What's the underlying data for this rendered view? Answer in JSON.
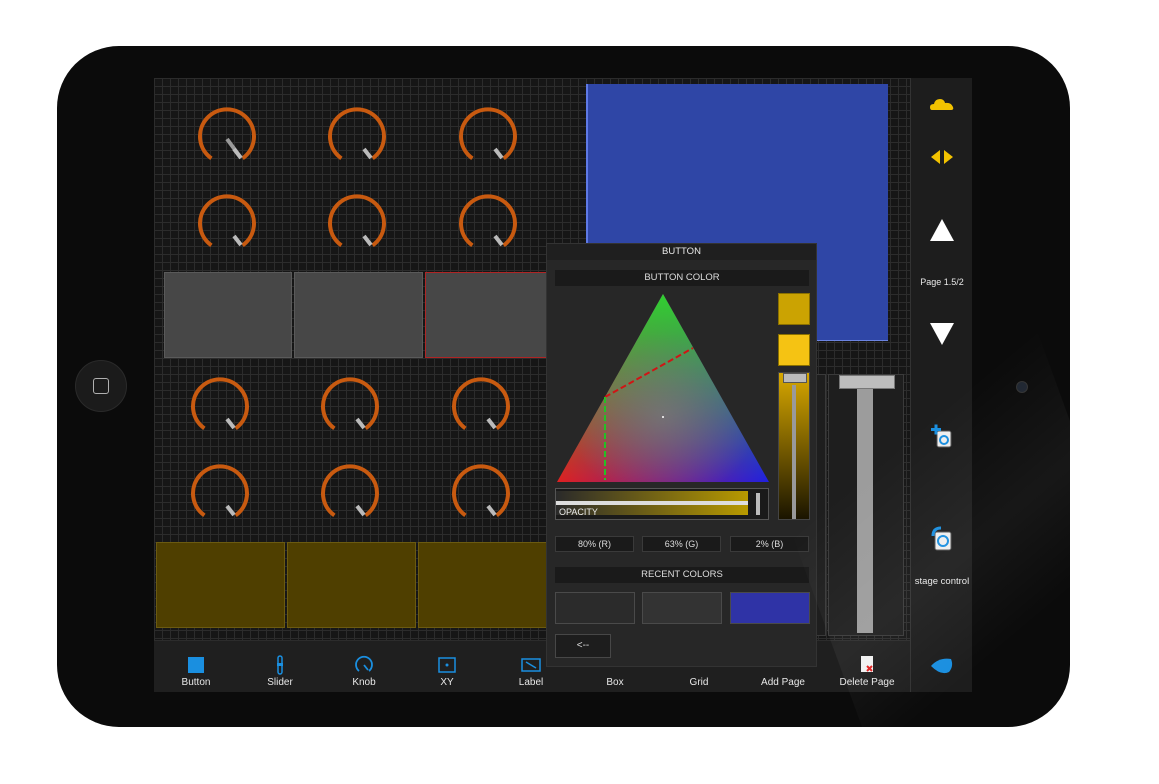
{
  "dialog": {
    "title": "BUTTON",
    "color_section": "BUTTON COLOR",
    "opacity_label": "OPACITY",
    "rgb": {
      "r": "80% (R)",
      "g": "63% (G)",
      "b": "2% (B)"
    },
    "recent_section": "RECENT COLORS",
    "recent_colors": [
      "#2b2b2b",
      "#333333",
      "#2f33a6"
    ],
    "back_label": "<--",
    "current_color": "#cba302",
    "new_color": "#f5c313"
  },
  "sidebar": {
    "page_label": "Page 1.5/2",
    "stage_label": "stage control",
    "icons": [
      "cloud-icon",
      "resize-horizontal-icon",
      "page-up-icon",
      "page-down-icon",
      "add-stage-icon",
      "stage-control-icon",
      "logo-drop-icon"
    ]
  },
  "toolbar": {
    "items": [
      {
        "label": "Button",
        "icon": "button-icon"
      },
      {
        "label": "Slider",
        "icon": "slider-icon"
      },
      {
        "label": "Knob",
        "icon": "knob-icon"
      },
      {
        "label": "XY",
        "icon": "xy-icon"
      },
      {
        "label": "Label",
        "icon": "label-icon"
      },
      {
        "label": "Box",
        "icon": "box-icon"
      },
      {
        "label": "Grid",
        "icon": "grid-icon"
      },
      {
        "label": "Add Page",
        "icon": "add-page-icon"
      },
      {
        "label": "Delete Page",
        "icon": "delete-page-icon"
      }
    ]
  },
  "colors": {
    "knob_arc": "#c85a10",
    "accent": "#1a8fe0",
    "yellow_icon": "#f2c200",
    "blue_box": "#2f46a6",
    "yellow_pad": "#4f3f00"
  }
}
